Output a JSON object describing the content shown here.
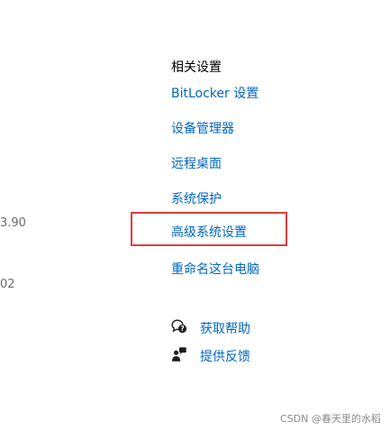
{
  "left_fragments": {
    "frag1": "3.90",
    "frag2": "02"
  },
  "related_settings": {
    "title": "相关设置",
    "links": [
      "BitLocker 设置",
      "设备管理器",
      "远程桌面",
      "系统保护",
      "高级系统设置",
      "重命名这台电脑"
    ]
  },
  "help": {
    "get_help": "获取帮助",
    "feedback": "提供反馈"
  },
  "watermark": "CSDN @春天里的水稻",
  "colors": {
    "link": "#0067c0",
    "highlight": "#e23b3b"
  },
  "icons": {
    "get_help": "help-chat-icon",
    "feedback": "feedback-person-icon"
  }
}
